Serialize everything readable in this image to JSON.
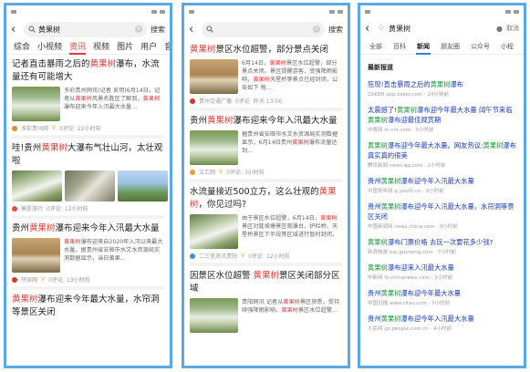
{
  "panel1": {
    "status_time": "",
    "query": "黄果树",
    "search_label": "搜索",
    "tabs": [
      "综合",
      "小视频",
      "资讯",
      "视频",
      "图片",
      "用户",
      "音"
    ],
    "active_tab": 2,
    "items": [
      {
        "title_parts": [
          [
            "记者直击暴雨之后的",
            false
          ],
          [
            "黄果树",
            true
          ],
          [
            "瀑布，水流量还有可能增大",
            false
          ]
        ],
        "snippet_parts": [
          [
            "多彩贵州网讯(记者 吴玥)6月14日，记者从",
            false
          ],
          [
            "黄果树",
            true
          ],
          [
            "风景名胜区了解到，",
            false
          ],
          [
            "黄果树",
            true
          ],
          [
            "瀑布迎来今年入汛最大水量...",
            false
          ]
        ],
        "source": "多彩贵州网",
        "verified": "V",
        "comments": "0评论",
        "time": "22小时前"
      },
      {
        "title_parts": [
          [
            "哇!贵州",
            false
          ],
          [
            "黄果树",
            true
          ],
          [
            "大瀑布气壮山河，太壮观啦",
            false
          ]
        ],
        "source": "莫愿旅行",
        "comments": "0评论",
        "time": "13小时前"
      },
      {
        "title_parts": [
          [
            "贵州",
            false
          ],
          [
            "黄果树",
            true
          ],
          [
            "瀑布迎来今年入汛最大水量",
            false
          ]
        ],
        "snippet_parts": [
          [
            "黄果树",
            true
          ],
          [
            "瀑布迎来自2020年入汛以来最大水量。据贵州省安顺市水文水资源局实测数据显示，当日黄果...",
            false
          ]
        ],
        "source": "环球网",
        "verified": "V",
        "comments": "0评论",
        "time": "13小时前"
      },
      {
        "title_parts": [
          [
            "黄果树",
            true
          ],
          [
            "瀑布迎来今年最大水量，水帘洞等景区关闭",
            false
          ]
        ]
      }
    ]
  },
  "panel2": {
    "query": "",
    "search_label": "搜索",
    "items": [
      {
        "title_parts": [
          [
            "黄果树",
            true
          ],
          [
            "景区水位超警，部分景点关闭",
            false
          ]
        ],
        "snippet_parts": [
          [
            "6月14日，",
            false
          ],
          [
            "黄果树",
            true
          ],
          [
            "景区水位超警，部分景点关闭。景区提醒游客，受强降雨影响，",
            false
          ],
          [
            "黄果树",
            true
          ],
          [
            "天星桥等景点已经封闭，公告如下 每...",
            false
          ]
        ],
        "source": "贵州交通广播",
        "comments": "0评论",
        "time": "昨天 13:56"
      },
      {
        "title_parts": [
          [
            "贵州",
            false
          ],
          [
            "黄果树",
            true
          ],
          [
            "瀑布迎来今年入汛最大水量",
            false
          ]
        ],
        "snippet_parts": [
          [
            "据贵州省安顺市水文水资源局实测数据显示，6月14日贵州",
            false
          ],
          [
            "黄果树",
            true
          ],
          [
            "瀑布流量达到...",
            false
          ]
        ],
        "source": "文汇网",
        "verified": "V",
        "comments": "0评论",
        "time": "3小时前"
      },
      {
        "title_parts": [
          [
            "水流量接近500立方，这么壮观的",
            false
          ],
          [
            "黄果树",
            true
          ],
          [
            "，你见过吗?",
            false
          ]
        ],
        "snippet_parts": [
          [
            "由于景区水位超警，6月14日，",
            false
          ],
          [
            "黄果树",
            true
          ],
          [
            "景区对陡坡塘景区观瀑台、护栏桥、天星桥景区下半段等区域进行暂时封闭。",
            false
          ]
        ],
        "source": "二三里资讯贵阳",
        "verified": "V",
        "comments": "0评论",
        "time": "12小时前"
      },
      {
        "title_parts": [
          [
            "因景区水位超警 ",
            false
          ],
          [
            "黄果树",
            true
          ],
          [
            "景区关闭部分区域",
            false
          ]
        ],
        "snippet_parts": [
          [
            "贵阳网讯 记者从",
            false
          ],
          [
            "黄果树",
            true
          ],
          [
            "景区获悉，受持续强降雨影响，",
            false
          ],
          [
            "黄果树",
            true
          ],
          [
            "景区水位超警...",
            false
          ]
        ]
      }
    ]
  },
  "panel3": {
    "query": "黄果树",
    "cancel_label": "取消",
    "tabs": [
      "全部",
      "百科",
      "新闻",
      "朋友圈",
      "公众号",
      "小程"
    ],
    "active_tab": 2,
    "latest_label": "最新报道",
    "items": [
      {
        "title_parts": [
          [
            "狂现!直击暴雨之后的",
            false
          ],
          [
            "黄果树",
            true
          ],
          [
            "瀑布",
            false
          ]
        ],
        "source": "ZAKER app.zaker.com · 24分钟前"
      },
      {
        "title_parts": [
          [
            "太震撼了!",
            false
          ],
          [
            "黄果树",
            true
          ],
          [
            "瀑布迎今年最大水量 阔午节来临",
            false
          ],
          [
            "黄果树",
            true
          ],
          [
            "瀑布迎最佳观赏期",
            false
          ]
        ],
        "source": "中青网 m.cnr.com · 3小时前"
      },
      {
        "title_parts": [
          [
            "黄果树",
            true
          ],
          [
            "瀑布迎今年最大水量。网友热议:",
            false
          ],
          [
            "黄果树",
            true
          ],
          [
            "瀑布真实真的很美",
            false
          ]
        ],
        "source": "腾讯新闻 news.qq.com · 2小时前"
      },
      {
        "title_parts": [
          [
            "贵州",
            false
          ],
          [
            "黄果树",
            true
          ],
          [
            "瀑布迎今年入汛最大水量",
            false
          ]
        ],
        "source": "中国青年网 q.youth.cn · 3小时前"
      },
      {
        "title_parts": [
          [
            "贵州",
            false
          ],
          [
            "黄果树",
            true
          ],
          [
            "瀑布迎今年入汛最大水量，水帘洞等景区关闭",
            false
          ]
        ],
        "source": "中国新闻网 news.china.com · 3小时前"
      },
      {
        "title_parts": [
          [
            "黄果树",
            true
          ],
          [
            "瀑布门票价格 去玩一次要花多少钱?",
            false
          ]
        ],
        "source": "新浪旅游 mp.gucheng.com · 7小时前"
      },
      {
        "title_parts": [
          [
            "黄果树",
            true
          ],
          [
            "瀑布迎来入汛最大水量",
            false
          ]
        ],
        "source": "中新网 fo.chinanews.com · 3小时前"
      },
      {
        "title_parts": [
          [
            "贵州",
            false
          ],
          [
            "黄果树",
            true
          ],
          [
            "瀑布迎今年最大水量",
            false
          ]
        ],
        "source": "中国日报 www.citav.com · 3小时前"
      },
      {
        "title_parts": [
          [
            "贵州",
            false
          ],
          [
            "黄果树",
            true
          ],
          [
            "瀑布迎今年入汛最大水量",
            false
          ]
        ],
        "source": "人民网 gz.people.com.cn · 4小时前"
      }
    ]
  }
}
